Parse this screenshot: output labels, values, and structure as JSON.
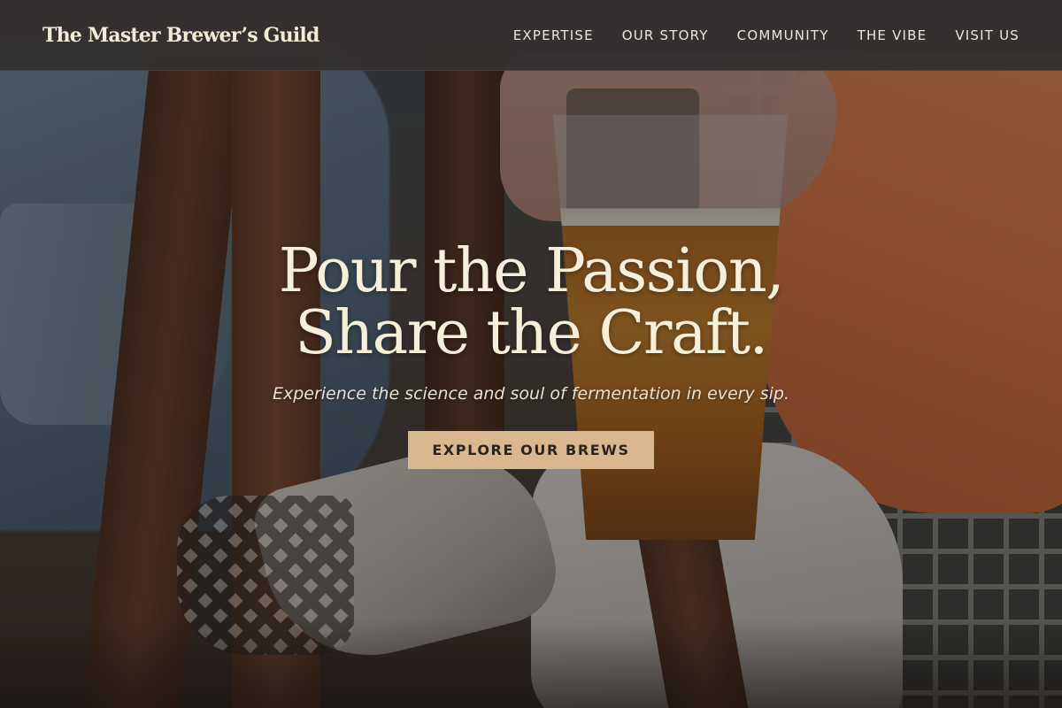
{
  "brand": {
    "name": "The Master Brewer’s Guild"
  },
  "nav": {
    "items": [
      {
        "label": "EXPERTISE"
      },
      {
        "label": "OUR STORY"
      },
      {
        "label": "COMMUNITY"
      },
      {
        "label": "THE VIBE"
      },
      {
        "label": "VISIT US"
      }
    ]
  },
  "hero": {
    "title_line_1": "Pour the Passion,",
    "title_line_2": "Share the Craft.",
    "subtitle": "Experience the science and soul of fermentation in every sip.",
    "cta_label": "EXPLORE OUR BREWS"
  },
  "colors": {
    "header_bg": "#34312f",
    "cta_bg": "#d9b88f",
    "title_text": "#f6efd9",
    "nav_text": "#ece6dc"
  }
}
